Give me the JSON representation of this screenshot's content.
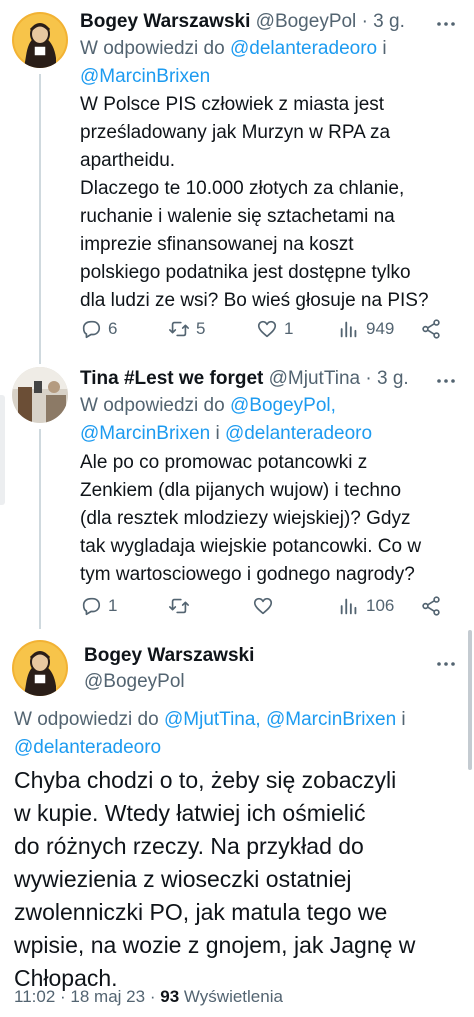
{
  "tweets": [
    {
      "name": "Bogey Warszawski",
      "handle": "@BogeyPol",
      "time": "3 g.",
      "reply_prefix": "W odpowiedzi do",
      "reply_line1_link": "@delanteradeoro",
      "reply_line1_suffix": "i",
      "reply_line2_link": "@MarcinBrixen",
      "text": "W Polsce PIS człowiek z miasta jest\nprześladowany jak Murzyn w RPA za\napartheidu.\nDlaczego te 10.000 złotych za chlanie,\nruchanie i walenie się sztachetami na\nimprezie sfinansowanej na koszt\npolskiego podatnika jest dostępne tylko\ndla ludzi ze wsi? Bo wieś głosuje na PIS?",
      "replies": "6",
      "retweets": "5",
      "likes": "1",
      "views": "949"
    },
    {
      "name": "Tina #Lest we forget",
      "handle": "@MjutTina",
      "time": "3 g.",
      "reply_prefix": "W odpowiedzi do",
      "reply_line1_link": "@BogeyPol,",
      "reply_line2_link_a": "@MarcinBrixen",
      "reply_line2_mid": "i",
      "reply_line2_link_b": "@delanteradeoro",
      "text": "Ale po co promowac potancowki z\nZenkiem (dla pijanych wujow) i techno\n(dla resztek mlodziezy wiejskiej)? Gdyz\ntak wygladaja wiejskie potancowki. Co w\ntym wartosciowego i godnego nagrody?",
      "replies": "1",
      "retweets": "",
      "likes": "",
      "views": "106"
    }
  ],
  "main": {
    "name": "Bogey Warszawski",
    "handle": "@BogeyPol",
    "reply_prefix": "W odpowiedzi do",
    "reply_link_a": "@MjutTina,",
    "reply_link_b": "@MarcinBrixen",
    "reply_mid": "i",
    "reply_link_c": "@delanteradeoro",
    "text": "Chyba chodzi o to, żeby się zobaczyli\nw kupie. Wtedy łatwiej ich ośmielić\ndo różnych rzeczy. Na przykład do\nwywiezienia z wioseczki ostatniej\nzwolenniczki PO, jak matula tego we\nwpisie, na wozie z gnojem, jak Jagnę w\nChłopach.",
    "time": "11:02",
    "date": "18 maj 23",
    "views_count": "93",
    "views_label": "Wyświetlenia"
  },
  "separator": "·",
  "icons": [
    "reply-icon",
    "retweet-icon",
    "like-icon",
    "views-icon",
    "share-icon",
    "more-icon"
  ],
  "colors": {
    "link": "#1d9bf0",
    "muted": "#536471",
    "text": "#0f1419"
  }
}
